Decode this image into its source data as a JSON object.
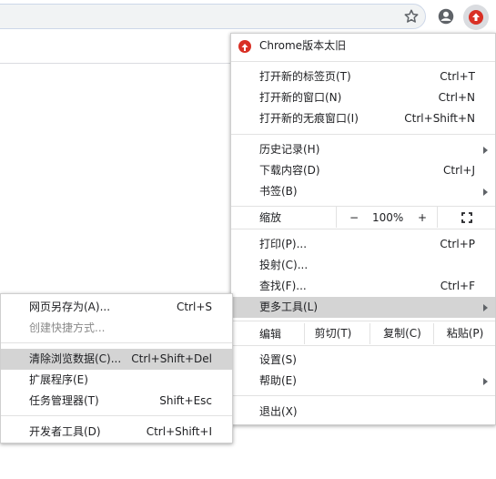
{
  "toolbar": {
    "star_icon": "star-outline-icon",
    "profile_icon": "account-circle-icon",
    "update_icon": "update-arrow-icon",
    "accent": "#d93025"
  },
  "menu": {
    "update_item": "Chrome版本太旧",
    "new_tab": {
      "label": "打开新的标签页(T)",
      "shortcut": "Ctrl+T"
    },
    "new_window": {
      "label": "打开新的窗口(N)",
      "shortcut": "Ctrl+N"
    },
    "incognito": {
      "label": "打开新的无痕窗口(I)",
      "shortcut": "Ctrl+Shift+N"
    },
    "history": {
      "label": "历史记录(H)"
    },
    "downloads": {
      "label": "下载内容(D)",
      "shortcut": "Ctrl+J"
    },
    "bookmarks": {
      "label": "书签(B)"
    },
    "zoom": {
      "label": "缩放",
      "minus": "−",
      "value": "100%",
      "plus": "+"
    },
    "print": {
      "label": "打印(P)...",
      "shortcut": "Ctrl+P"
    },
    "cast": {
      "label": "投射(C)..."
    },
    "find": {
      "label": "查找(F)...",
      "shortcut": "Ctrl+F"
    },
    "more_tools": {
      "label": "更多工具(L)"
    },
    "edit": {
      "label": "编辑",
      "cut": "剪切(T)",
      "copy": "复制(C)",
      "paste": "粘贴(P)"
    },
    "settings": {
      "label": "设置(S)"
    },
    "help": {
      "label": "帮助(E)"
    },
    "exit": {
      "label": "退出(X)"
    }
  },
  "submenu": {
    "save_as": {
      "label": "网页另存为(A)...",
      "shortcut": "Ctrl+S"
    },
    "create_shortcut": {
      "label": "创建快捷方式..."
    },
    "clear_data": {
      "label": "清除浏览数据(C)...",
      "shortcut": "Ctrl+Shift+Del"
    },
    "extensions": {
      "label": "扩展程序(E)"
    },
    "task_manager": {
      "label": "任务管理器(T)",
      "shortcut": "Shift+Esc"
    },
    "dev_tools": {
      "label": "开发者工具(D)",
      "shortcut": "Ctrl+Shift+I"
    }
  }
}
